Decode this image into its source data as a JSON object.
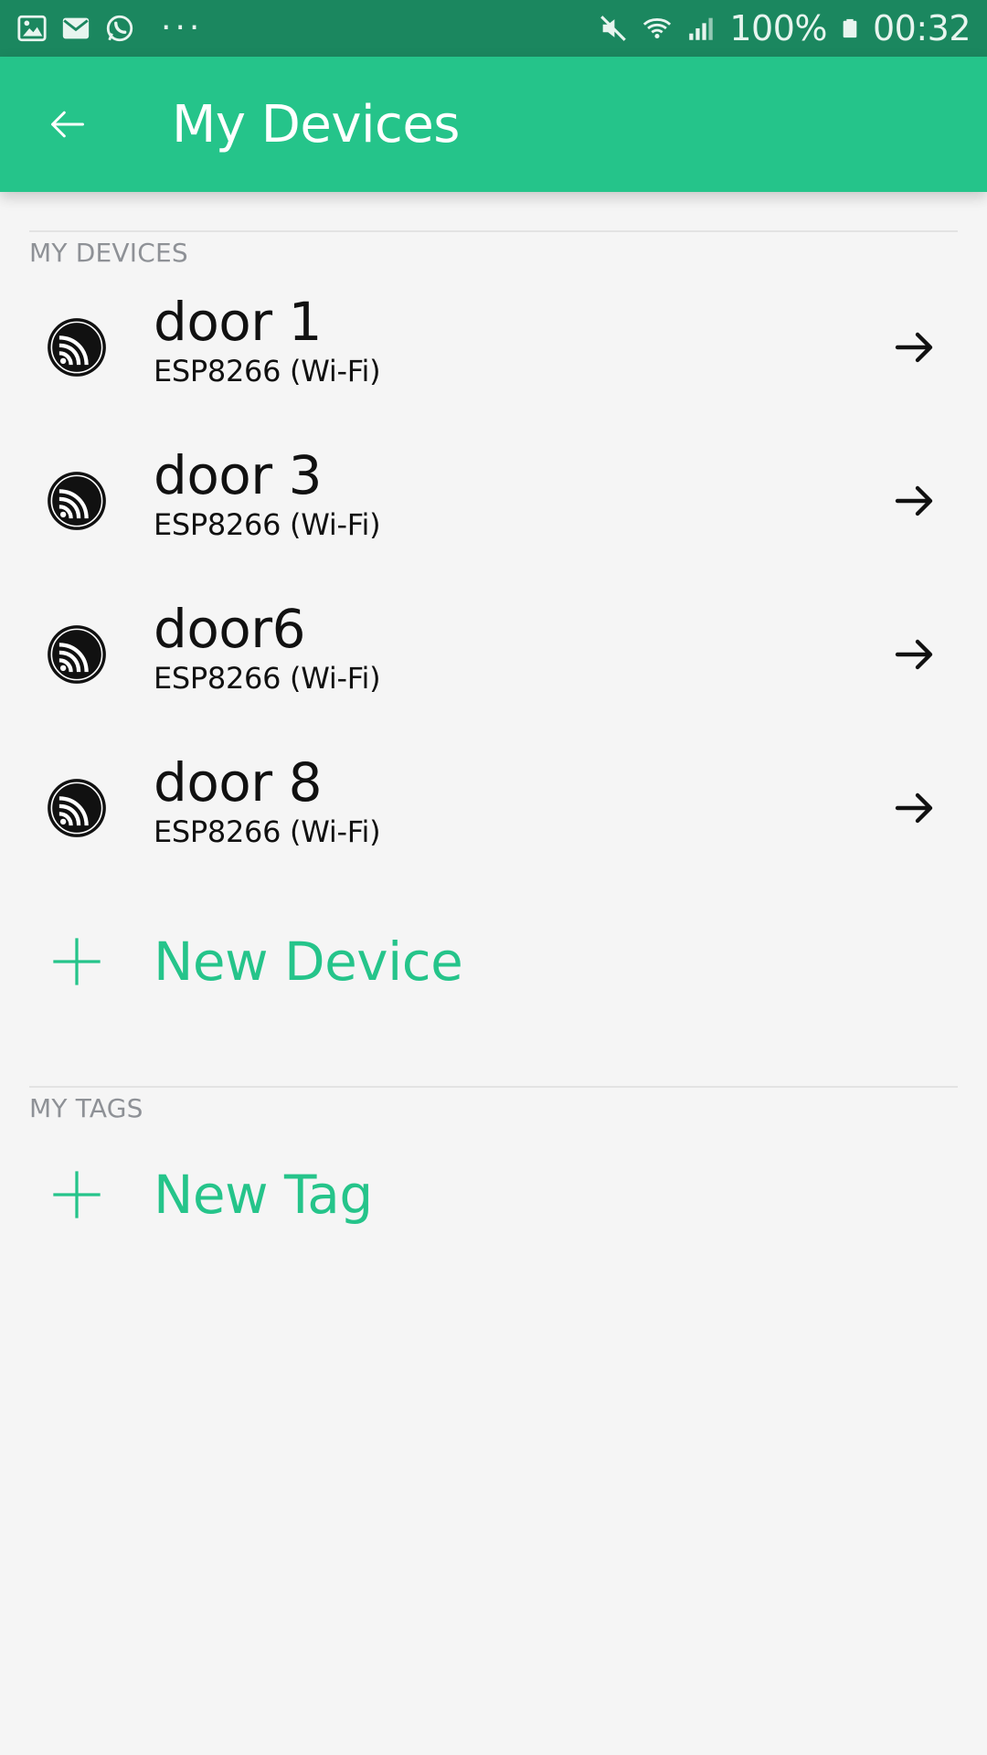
{
  "status_bar": {
    "battery": "100%",
    "time": "00:32",
    "more": "···",
    "left_icons": [
      "image-icon",
      "email-icon",
      "whatsapp-icon"
    ],
    "right_icons": [
      "mute-icon",
      "wifi-icon",
      "signal-icon",
      "battery-icon"
    ]
  },
  "app_bar": {
    "title": "My Devices",
    "back_icon": "arrow-left-icon"
  },
  "sections": {
    "devices_header": "MY DEVICES",
    "tags_header": "MY TAGS"
  },
  "devices": [
    {
      "name": "door 1",
      "type": "ESP8266 (Wi-Fi)"
    },
    {
      "name": "door 3",
      "type": "ESP8266 (Wi-Fi)"
    },
    {
      "name": "door6",
      "type": "ESP8266 (Wi-Fi)"
    },
    {
      "name": "door 8",
      "type": "ESP8266 (Wi-Fi)"
    }
  ],
  "actions": {
    "new_device": "New Device",
    "new_tag": "New Tag"
  },
  "colors": {
    "status_bar": "#1b875f",
    "app_bar": "#25c48a",
    "accent": "#25c48a",
    "background": "#f5f5f5"
  }
}
